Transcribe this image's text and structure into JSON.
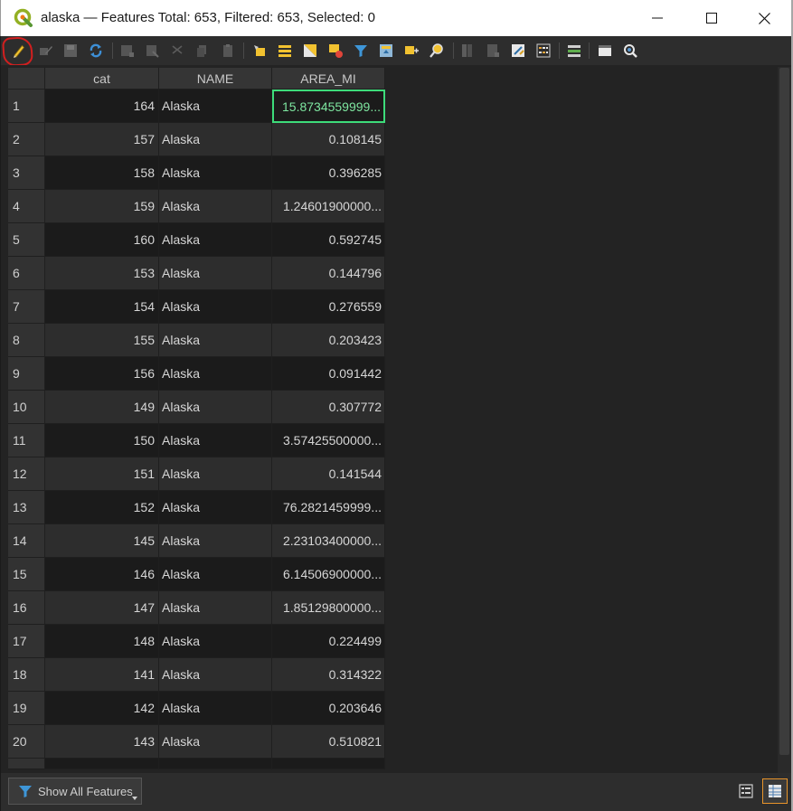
{
  "window": {
    "title": "alaska — Features Total: 653, Filtered: 653, Selected: 0",
    "app_icon": "qgis-logo-icon"
  },
  "toolbar": {
    "buttons": [
      {
        "name": "toggle-editing-icon",
        "label": "Toggle editing mode",
        "highlighted": true
      },
      {
        "name": "toggle-multi-edit-icon",
        "label": "Toggle multi edit mode"
      },
      {
        "name": "save-edits-icon",
        "label": "Save edits"
      },
      {
        "name": "reload-table-icon",
        "label": "Reload the table"
      },
      {
        "name": "add-feature-icon",
        "label": "Add feature"
      },
      {
        "name": "delete-selected-icon",
        "label": "Delete selected features"
      },
      {
        "name": "cut-icon",
        "label": "Cut selected rows"
      },
      {
        "name": "copy-icon",
        "label": "Copy selected rows"
      },
      {
        "name": "paste-icon",
        "label": "Paste features"
      },
      {
        "name": "select-by-expression-icon",
        "label": "Select features using an expression"
      },
      {
        "name": "select-all-icon",
        "label": "Select all"
      },
      {
        "name": "invert-selection-icon",
        "label": "Invert selection"
      },
      {
        "name": "deselect-all-icon",
        "label": "Deselect all"
      },
      {
        "name": "filter-select-icon",
        "label": "Filter/Select features using form"
      },
      {
        "name": "move-selection-to-top-icon",
        "label": "Move selection to top"
      },
      {
        "name": "pan-to-selected-icon",
        "label": "Pan map to selected rows"
      },
      {
        "name": "zoom-to-selected-icon",
        "label": "Zoom map to selected rows"
      },
      {
        "name": "new-field-icon",
        "label": "New field"
      },
      {
        "name": "delete-field-icon",
        "label": "Delete field"
      },
      {
        "name": "field-calculator-icon",
        "label": "Open field calculator"
      },
      {
        "name": "conditional-formatting-icon",
        "label": "Conditional formatting"
      },
      {
        "name": "organize-columns-icon",
        "label": "Organize columns"
      },
      {
        "name": "dock-table-icon",
        "label": "Dock attribute table"
      },
      {
        "name": "actions-icon",
        "label": "Actions"
      }
    ]
  },
  "table": {
    "columns": [
      "cat",
      "NAME",
      "AREA_MI"
    ],
    "rows": [
      {
        "num": "1",
        "cat": "164",
        "name": "Alaska",
        "area": "15.8734559999..."
      },
      {
        "num": "2",
        "cat": "157",
        "name": "Alaska",
        "area": "0.108145"
      },
      {
        "num": "3",
        "cat": "158",
        "name": "Alaska",
        "area": "0.396285"
      },
      {
        "num": "4",
        "cat": "159",
        "name": "Alaska",
        "area": "1.24601900000..."
      },
      {
        "num": "5",
        "cat": "160",
        "name": "Alaska",
        "area": "0.592745"
      },
      {
        "num": "6",
        "cat": "153",
        "name": "Alaska",
        "area": "0.144796"
      },
      {
        "num": "7",
        "cat": "154",
        "name": "Alaska",
        "area": "0.276559"
      },
      {
        "num": "8",
        "cat": "155",
        "name": "Alaska",
        "area": "0.203423"
      },
      {
        "num": "9",
        "cat": "156",
        "name": "Alaska",
        "area": "0.091442"
      },
      {
        "num": "10",
        "cat": "149",
        "name": "Alaska",
        "area": "0.307772"
      },
      {
        "num": "11",
        "cat": "150",
        "name": "Alaska",
        "area": "3.57425500000..."
      },
      {
        "num": "12",
        "cat": "151",
        "name": "Alaska",
        "area": "0.141544"
      },
      {
        "num": "13",
        "cat": "152",
        "name": "Alaska",
        "area": "76.2821459999..."
      },
      {
        "num": "14",
        "cat": "145",
        "name": "Alaska",
        "area": "2.23103400000..."
      },
      {
        "num": "15",
        "cat": "146",
        "name": "Alaska",
        "area": "6.14506900000..."
      },
      {
        "num": "16",
        "cat": "147",
        "name": "Alaska",
        "area": "1.85129800000..."
      },
      {
        "num": "17",
        "cat": "148",
        "name": "Alaska",
        "area": "0.224499"
      },
      {
        "num": "18",
        "cat": "141",
        "name": "Alaska",
        "area": "0.314322"
      },
      {
        "num": "19",
        "cat": "142",
        "name": "Alaska",
        "area": "0.203646"
      },
      {
        "num": "20",
        "cat": "143",
        "name": "Alaska",
        "area": "0.510821"
      }
    ]
  },
  "bottom": {
    "filter_label": "Show All Features",
    "filter_icon": "filter-funnel-icon",
    "view_buttons": [
      "form-view-icon",
      "table-view-icon"
    ],
    "active_view": "table-view-icon"
  },
  "colors": {
    "current_cell_border": "#3ddc7a",
    "edit_highlight_circle": "#d21f1f",
    "active_view_border": "#e8942a"
  }
}
